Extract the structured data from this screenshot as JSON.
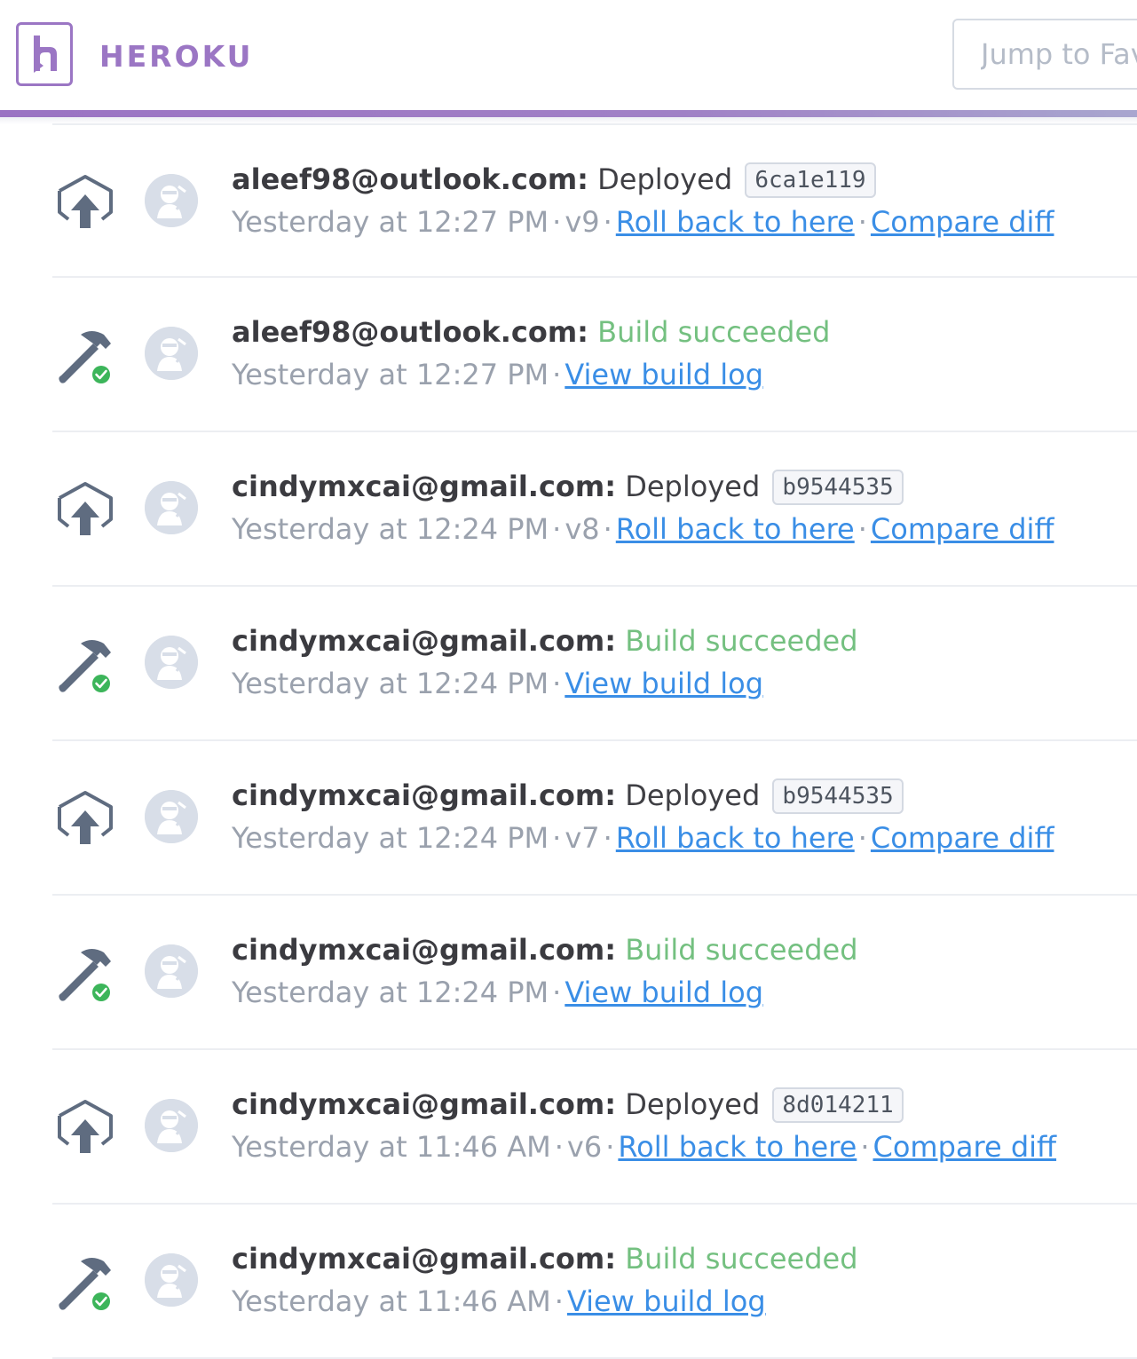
{
  "header": {
    "brand": "HEROKU",
    "search_placeholder": "Jump to Fav"
  },
  "colors": {
    "brand_purple": "#9b76c4",
    "success_green": "#74c080",
    "link_blue": "#3a8ee6",
    "muted_gray": "#9aa1ad",
    "icon_slate": "#5f6c80"
  },
  "activities": [
    {
      "type": "deploy",
      "icon": "deploy-icon",
      "actor": "aleef98@outlook.com:",
      "action": "Deployed",
      "sha": "6ca1e119",
      "time": "Yesterday at 12:27 PM",
      "version": "v9",
      "rollback_label": "Roll back to here",
      "compare_label": "Compare diff"
    },
    {
      "type": "build",
      "icon": "build-success-icon",
      "actor": "aleef98@outlook.com:",
      "action": "Build succeeded",
      "time": "Yesterday at 12:27 PM",
      "log_label": "View build log"
    },
    {
      "type": "deploy",
      "icon": "deploy-icon",
      "actor": "cindymxcai@gmail.com:",
      "action": "Deployed",
      "sha": "b9544535",
      "time": "Yesterday at 12:24 PM",
      "version": "v8",
      "rollback_label": "Roll back to here",
      "compare_label": "Compare diff"
    },
    {
      "type": "build",
      "icon": "build-success-icon",
      "actor": "cindymxcai@gmail.com:",
      "action": "Build succeeded",
      "time": "Yesterday at 12:24 PM",
      "log_label": "View build log"
    },
    {
      "type": "deploy",
      "icon": "deploy-icon",
      "actor": "cindymxcai@gmail.com:",
      "action": "Deployed",
      "sha": "b9544535",
      "time": "Yesterday at 12:24 PM",
      "version": "v7",
      "rollback_label": "Roll back to here",
      "compare_label": "Compare diff"
    },
    {
      "type": "build",
      "icon": "build-success-icon",
      "actor": "cindymxcai@gmail.com:",
      "action": "Build succeeded",
      "time": "Yesterday at 12:24 PM",
      "log_label": "View build log"
    },
    {
      "type": "deploy",
      "icon": "deploy-icon",
      "actor": "cindymxcai@gmail.com:",
      "action": "Deployed",
      "sha": "8d014211",
      "time": "Yesterday at 11:46 AM",
      "version": "v6",
      "rollback_label": "Roll back to here",
      "compare_label": "Compare diff"
    },
    {
      "type": "build",
      "icon": "build-success-icon",
      "actor": "cindymxcai@gmail.com:",
      "action": "Build succeeded",
      "time": "Yesterday at 11:46 AM",
      "log_label": "View build log"
    }
  ]
}
